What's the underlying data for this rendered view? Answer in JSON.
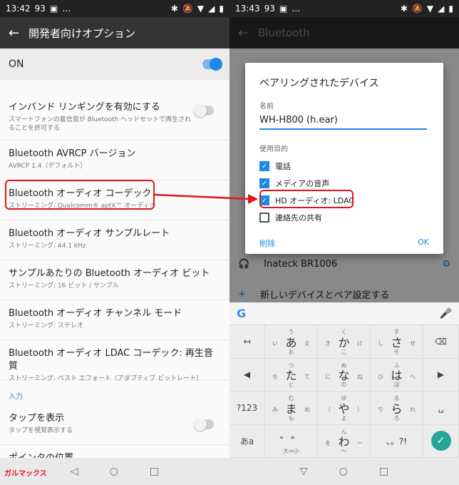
{
  "left": {
    "status": {
      "time": "13:42",
      "battery": "93",
      "extra": "…"
    },
    "title": "開発者向けオプション",
    "on_label": "ON",
    "items": [
      {
        "title": "インバンド リンギングを有効にする",
        "subtitle": "スマートフォンの着信音が Bluetooth ヘッドセットで再生されることを許可する"
      },
      {
        "title": "Bluetooth AVRCP バージョン",
        "subtitle": "AVRCP 1.4（デフォルト）"
      },
      {
        "title": "Bluetooth オーディオ コーデック",
        "subtitle": "ストリーミング: Qualcomm® aptX™ オーディオ"
      },
      {
        "title": "Bluetooth オーディオ サンプルレート",
        "subtitle": "ストリーミング: 44.1 kHz"
      },
      {
        "title": "サンプルあたりの Bluetooth オーディオ ビット",
        "subtitle": "ストリーミング: 16 ビット / サンプル"
      },
      {
        "title": "Bluetooth オーディオ チャンネル モード",
        "subtitle": "ストリーミング: ステレオ"
      },
      {
        "title": "Bluetooth オーディオ LDAC コーデック: 再生音質",
        "subtitle": "ストリーミング: ベスト エフォート（アダプティブ ビットレート）"
      }
    ],
    "section_label": "入力",
    "tap_item": {
      "title": "タップを表示",
      "subtitle": "タップを視覚表示する"
    },
    "partial_item": "ポインタの位置",
    "logo": "ガルマックス"
  },
  "right": {
    "status": {
      "time": "13:43",
      "battery": "93",
      "extra": "…"
    },
    "title": "Bluetooth",
    "dialog": {
      "title": "ペアリングされたデバイス",
      "name_label": "名前",
      "name_value": "WH-H800 (h.ear)",
      "purpose_label": "使用目的",
      "options": [
        {
          "label": "電話",
          "checked": true
        },
        {
          "label": "メディアの音声",
          "checked": true
        },
        {
          "label": "HD オーディオ: LDAC",
          "checked": true
        },
        {
          "label": "連絡先の共有",
          "checked": false
        }
      ],
      "delete_label": "削除",
      "ok_label": "OK"
    },
    "device2": "Inateck BR1006",
    "pair_new": "新しいデバイスとペア設定する",
    "keyboard": {
      "google": "G",
      "keys": [
        {
          "main": "あ",
          "top": "う",
          "left": "い",
          "right": "え",
          "bottom": "お"
        },
        {
          "main": "か",
          "top": "く",
          "left": "き",
          "right": "け",
          "bottom": "こ"
        },
        {
          "main": "さ",
          "top": "す",
          "left": "し",
          "right": "せ",
          "bottom": "そ"
        },
        {
          "main": "た",
          "top": "つ",
          "left": "ち",
          "right": "て",
          "bottom": "と"
        },
        {
          "main": "な",
          "top": "ぬ",
          "left": "に",
          "right": "ね",
          "bottom": "の"
        },
        {
          "main": "は",
          "top": "ふ",
          "left": "ひ",
          "right": "へ",
          "bottom": "ほ"
        },
        {
          "main": "ま",
          "top": "む",
          "left": "み",
          "right": "め",
          "bottom": "も"
        },
        {
          "main": "や",
          "top": "ゆ",
          "left": "（",
          "right": "）",
          "bottom": "よ"
        },
        {
          "main": "ら",
          "top": "る",
          "left": "り",
          "right": "れ",
          "bottom": "ろ"
        },
        {
          "main": "゛゜",
          "top": "",
          "left": "",
          "right": "",
          "bottom": "大⇔小"
        },
        {
          "main": "わ",
          "top": "ん",
          "left": "を",
          "right": "ー",
          "bottom": "〜"
        },
        {
          "main": "、。?!",
          "top": "",
          "left": "",
          "right": "",
          "bottom": ""
        }
      ],
      "num_label": "?123",
      "kana_label": "あa"
    }
  }
}
